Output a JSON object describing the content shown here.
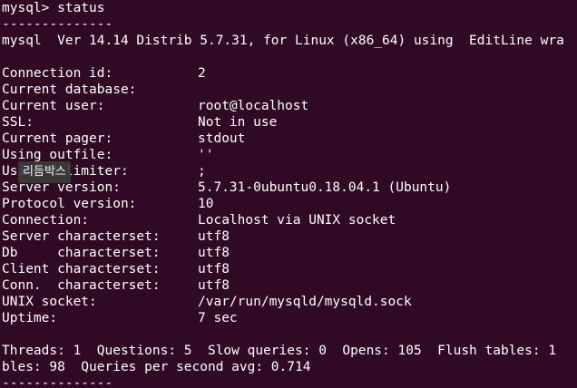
{
  "terminal": {
    "prompt": "mysql> ",
    "command": "status",
    "separator_top": "--------------",
    "version_line": "mysql  Ver 14.14 Distrib 5.7.31, for Linux (x86_64) using  EditLine wra",
    "fields": [
      {
        "key": "Connection id:",
        "value": "2"
      },
      {
        "key": "Current database:",
        "value": ""
      },
      {
        "key": "Current user:",
        "value": "root@localhost"
      },
      {
        "key": "SSL:",
        "value": "Not in use"
      },
      {
        "key": "Current pager:",
        "value": "stdout"
      },
      {
        "key": "Using outfile:",
        "value": "''"
      },
      {
        "key": "Using delimiter:",
        "value": ";"
      },
      {
        "key": "Server version:",
        "value": "5.7.31-0ubuntu0.18.04.1 (Ubuntu)"
      },
      {
        "key": "Protocol version:",
        "value": "10"
      },
      {
        "key": "Connection:",
        "value": "Localhost via UNIX socket"
      },
      {
        "key": "Server characterset:",
        "value": "utf8"
      },
      {
        "key": "Db     characterset:",
        "value": "utf8"
      },
      {
        "key": "Client characterset:",
        "value": "utf8"
      },
      {
        "key": "Conn.  characterset:",
        "value": "utf8"
      },
      {
        "key": "UNIX socket:",
        "value": "/var/run/mysqld/mysqld.sock"
      },
      {
        "key": "Uptime:",
        "value": "7 sec"
      }
    ],
    "stats_line_1": "Threads: 1  Questions: 5  Slow queries: 0  Opens: 105  Flush tables: 1",
    "stats_line_2": "bles: 98  Queries per second avg: 0.714",
    "separator_bottom": "--------------"
  },
  "tooltip": {
    "label": "리듬박스"
  },
  "colors": {
    "background": "#300a24",
    "text": "#ffffff"
  }
}
